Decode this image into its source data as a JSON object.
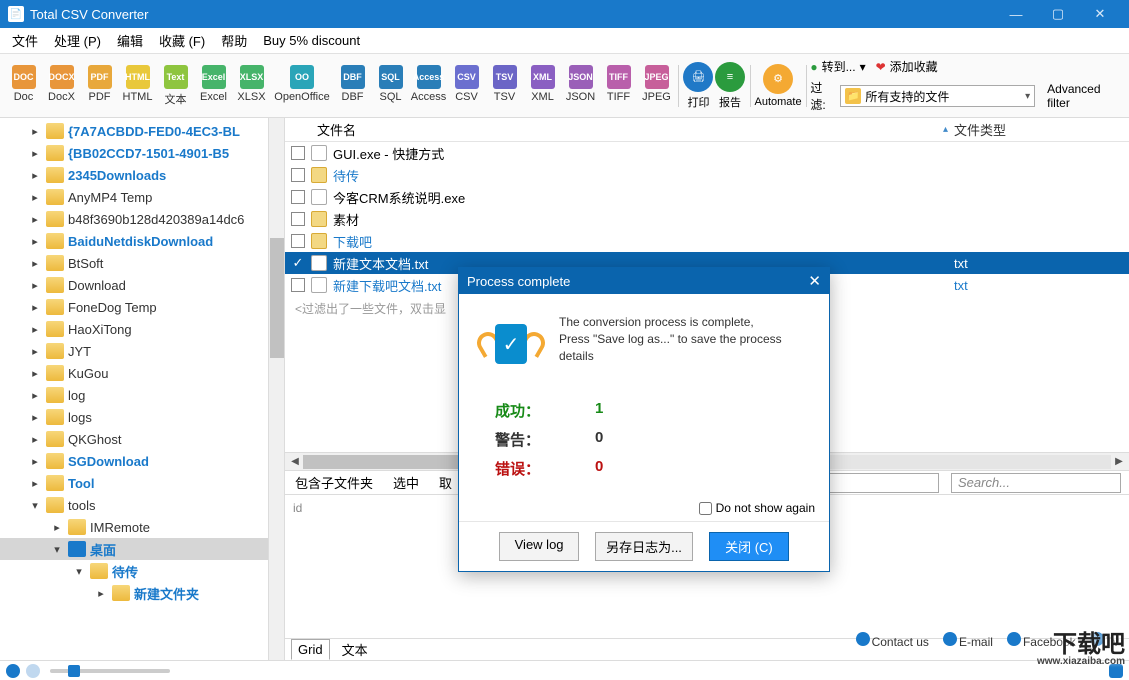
{
  "window": {
    "title": "Total CSV Converter"
  },
  "menu": [
    "文件",
    "处理 (P)",
    "编辑",
    "收藏 (F)",
    "帮助",
    "Buy 5% discount"
  ],
  "toolbar": {
    "formats": [
      {
        "label": "Doc",
        "ic": "DOC",
        "bg": "#e8963b"
      },
      {
        "label": "DocX",
        "ic": "DOCX",
        "bg": "#e8963b"
      },
      {
        "label": "PDF",
        "ic": "PDF",
        "bg": "#e8a83b"
      },
      {
        "label": "HTML",
        "ic": "HTML",
        "bg": "#e9c83b"
      },
      {
        "label": "文本",
        "ic": "Text",
        "bg": "#8ec53f"
      },
      {
        "label": "Excel",
        "ic": "Excel",
        "bg": "#46b46a"
      },
      {
        "label": "XLSX",
        "ic": "XLSX",
        "bg": "#46b46a"
      },
      {
        "label": "OpenOffice",
        "ic": "OO",
        "bg": "#2aa5b8",
        "w": true
      },
      {
        "label": "DBF",
        "ic": "DBF",
        "bg": "#2a7eb8"
      },
      {
        "label": "SQL",
        "ic": "SQL",
        "bg": "#2a7eb8"
      },
      {
        "label": "Access",
        "ic": "Access",
        "bg": "#2a7eb8"
      },
      {
        "label": "CSV",
        "ic": "CSV",
        "bg": "#6b6fcf"
      },
      {
        "label": "TSV",
        "ic": "TSV",
        "bg": "#6b65c6"
      },
      {
        "label": "XML",
        "ic": "XML",
        "bg": "#8a5fc2"
      },
      {
        "label": "JSON",
        "ic": "JSON",
        "bg": "#9a5fb8"
      },
      {
        "label": "TIFF",
        "ic": "TIFF",
        "bg": "#b95fab"
      },
      {
        "label": "JPEG",
        "ic": "JPEG",
        "bg": "#c75f9a"
      }
    ],
    "print": "打印",
    "report": "报告",
    "automate": "Automate",
    "goto": "转到...",
    "fav": "添加收藏",
    "filter_label": "过滤:",
    "filter_value": "所有支持的文件",
    "adv": "Advanced filter"
  },
  "tree": [
    {
      "lbl": "{7A7ACBDD-FED0-4EC3-BL",
      "ind": 1,
      "blue": true
    },
    {
      "lbl": "{BB02CCD7-1501-4901-B5",
      "ind": 1,
      "blue": true
    },
    {
      "lbl": "2345Downloads",
      "ind": 1,
      "blue": true
    },
    {
      "lbl": "AnyMP4 Temp",
      "ind": 1
    },
    {
      "lbl": "b48f3690b128d420389a14dc6",
      "ind": 1
    },
    {
      "lbl": "BaiduNetdiskDownload",
      "ind": 1,
      "blue": true
    },
    {
      "lbl": "BtSoft",
      "ind": 1
    },
    {
      "lbl": "Download",
      "ind": 1
    },
    {
      "lbl": "FoneDog Temp",
      "ind": 1
    },
    {
      "lbl": "HaoXiTong",
      "ind": 1
    },
    {
      "lbl": "JYT",
      "ind": 1
    },
    {
      "lbl": "KuGou",
      "ind": 1
    },
    {
      "lbl": "log",
      "ind": 1
    },
    {
      "lbl": "logs",
      "ind": 1
    },
    {
      "lbl": "QKGhost",
      "ind": 1
    },
    {
      "lbl": "SGDownload",
      "ind": 1,
      "blue": true
    },
    {
      "lbl": "Tool",
      "ind": 1,
      "blue": true
    },
    {
      "lbl": "tools",
      "ind": 1,
      "open": true
    },
    {
      "lbl": "IMRemote",
      "ind": 2
    },
    {
      "lbl": "桌面",
      "ind": 2,
      "open": true,
      "sel": true,
      "blue": true,
      "desk": true
    },
    {
      "lbl": "待传",
      "ind": 3,
      "open": true,
      "blue": true
    },
    {
      "lbl": "新建文件夹",
      "ind": 4,
      "blue": true
    }
  ],
  "filehead": {
    "name": "文件名",
    "type": "文件类型"
  },
  "files": [
    {
      "name": "GUI.exe - 快捷方式",
      "folder": false
    },
    {
      "name": "待传",
      "blue": true,
      "folder": true
    },
    {
      "name": "今客CRM系统说明.exe",
      "folder": false
    },
    {
      "name": "素材",
      "folder": true
    },
    {
      "name": "下载吧",
      "blue": true,
      "folder": true
    },
    {
      "name": "新建文本文档.txt",
      "blue": true,
      "type": "txt",
      "checked": true,
      "sel": true,
      "folder": false
    },
    {
      "name": "新建下载吧文档.txt",
      "blue": true,
      "type": "txt",
      "folder": false
    }
  ],
  "filter_note": "<过滤出了一些文件，双击显",
  "midtabs": {
    "sub": "包含子文件夹",
    "sel": "选中",
    "all": "取",
    "search": "Search..."
  },
  "detail": {
    "id": "id"
  },
  "bottabs": {
    "grid": "Grid",
    "text": "文本"
  },
  "dialog": {
    "title": "Process complete",
    "msg1": "The conversion process is complete,",
    "msg2": "Press \"Save log as...\" to save the process details",
    "success_k": "成功：",
    "success_v": "1",
    "warn_k": "警告：",
    "warn_v": "0",
    "err_k": "错误：",
    "err_v": "0",
    "noshow": "Do not show again",
    "viewlog": "View log",
    "savelog": "另存日志为...",
    "close": "关闭 (C)"
  },
  "footer": {
    "contact": "Contact us",
    "email": "E-mail",
    "fb": "Facebook",
    "tw": "Tv"
  }
}
